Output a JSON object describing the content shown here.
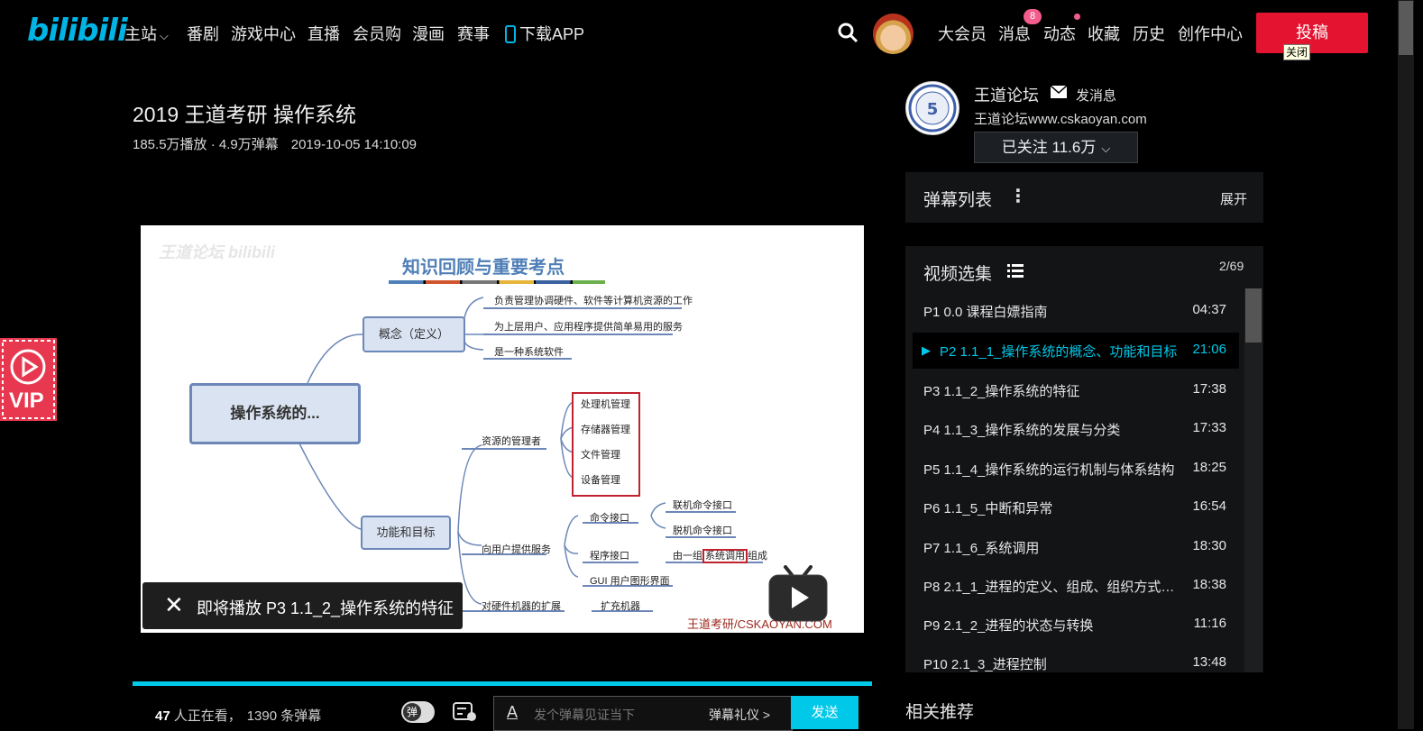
{
  "header": {
    "logo": "bilibili",
    "nav": [
      "主站",
      "番剧",
      "游戏中心",
      "直播",
      "会员购",
      "漫画",
      "赛事",
      "下载APP"
    ],
    "right": {
      "vip": "大会员",
      "messages": "消息",
      "messages_badge": "8",
      "dynamics": "动态",
      "favorites": "收藏",
      "history": "历史",
      "creator": "创作中心"
    },
    "upload": "投稿",
    "tooltip": "关闭"
  },
  "video": {
    "title": "2019 王道考研 操作系统",
    "meta": "185.5万播放 · 4.9万弹幕",
    "date": "2019-10-05 14:10:09",
    "next_popup": "即将播放 P3 1.1_2_操作系统的特征"
  },
  "slide": {
    "header": "知识回顾与重要考点",
    "root": "操作系统的...",
    "concept": "概念（定义）",
    "concept_items": [
      "负责管理协调硬件、软件等计算机资源的工作",
      "为上层用户、应用程序提供简单易用的服务",
      "是一种系统软件"
    ],
    "goals": "功能和目标",
    "resource_manager": "资源的管理者",
    "resource_items": [
      "处理机管理",
      "存储器管理",
      "文件管理",
      "设备管理"
    ],
    "user_services": "向用户提供服务",
    "cmd_interface": "命令接口",
    "cmd_items": [
      "联机命令接口",
      "脱机命令接口"
    ],
    "prog_interface": "程序接口",
    "prog_desc_prefix": "由一组",
    "prog_desc_highlight": "系统调用",
    "prog_desc_suffix": "组成",
    "gui": "GUI 用户图形界面",
    "hw_extension": "对硬件机器的扩展",
    "expand_machine": "扩充机器",
    "watermark": "王道考研/CSKAOYAN.COM"
  },
  "player_bar": {
    "watching_count": "47",
    "watching_text": "人正在看，",
    "danmu_count": "1390 条弹幕",
    "toggle_label": "弹",
    "input_placeholder": "发个弹幕见证当下",
    "etiquette": "弹幕礼仪 >",
    "send": "发送"
  },
  "up": {
    "name": "王道论坛",
    "message": "发消息",
    "desc": "王道论坛www.cskaoyan.com",
    "follow": "已关注 11.6万"
  },
  "danmu_panel": {
    "title": "弹幕列表",
    "expand": "展开"
  },
  "episodes": {
    "title": "视频选集",
    "counter": "2/69",
    "items": [
      {
        "title": "P1   0.0 课程白嫖指南",
        "duration": "04:37"
      },
      {
        "title": "P2   1.1_1_操作系统的概念、功能和目标",
        "duration": "21:06"
      },
      {
        "title": "P3   1.1_2_操作系统的特征",
        "duration": "17:38"
      },
      {
        "title": "P4   1.1_3_操作系统的发展与分类",
        "duration": "17:33"
      },
      {
        "title": "P5   1.1_4_操作系统的运行机制与体系结构",
        "duration": "18:25"
      },
      {
        "title": "P6   1.1_5_中断和异常",
        "duration": "16:54"
      },
      {
        "title": "P7   1.1_6_系统调用",
        "duration": "18:30"
      },
      {
        "title": "P8   2.1_1_进程的定义、组成、组织方式…",
        "duration": "18:38"
      },
      {
        "title": "P9   2.1_2_进程的状态与转换",
        "duration": "11:16"
      },
      {
        "title": "P10   2.1_3_进程控制",
        "duration": "13:48"
      }
    ]
  },
  "related": "相关推荐",
  "vip_badge": "VIP"
}
